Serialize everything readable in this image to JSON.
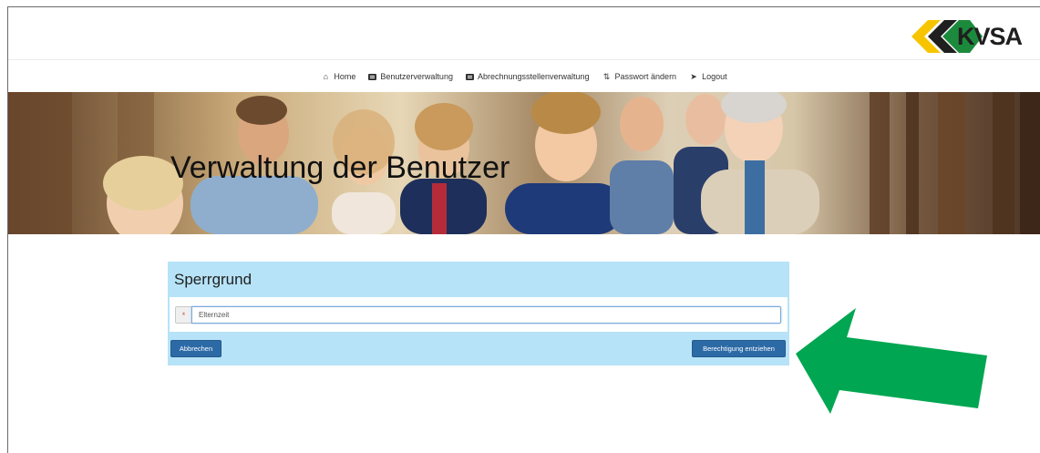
{
  "brand": {
    "name": "KVSA",
    "colors": {
      "yellow": "#f7c500",
      "green": "#1c8a3c",
      "black": "#1f1f1f"
    }
  },
  "nav": {
    "items": [
      {
        "label": "Home",
        "icon": "home-icon"
      },
      {
        "label": "Benutzerverwaltung",
        "icon": "list-icon"
      },
      {
        "label": "Abrechnungsstellenverwaltung",
        "icon": "list-icon"
      },
      {
        "label": "Passwort ändern",
        "icon": "retweet-icon"
      },
      {
        "label": "Logout",
        "icon": "logout-icon"
      }
    ]
  },
  "banner": {
    "title": "Verwaltung der Benutzer"
  },
  "form": {
    "title": "Sperrgrund",
    "required_marker": "*",
    "reason_value": "Elternzeit",
    "cancel_label": "Abbrechen",
    "submit_label": "Berechtigung entziehen",
    "panel_color": "#b6e3f7",
    "button_color": "#2c6aa6"
  },
  "annotation": {
    "arrow_color": "#00a651"
  }
}
